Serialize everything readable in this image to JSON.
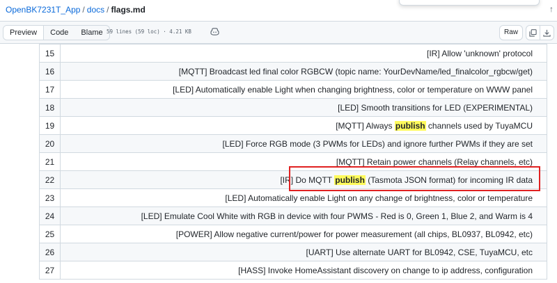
{
  "breadcrumb": {
    "repo": "OpenBK7231T_App",
    "dir": "docs",
    "file": "flags.md"
  },
  "toolbar": {
    "preview": "Preview",
    "code": "Code",
    "blame": "Blame",
    "file_meta": "59 lines (59 loc) · 4.21 KB",
    "raw": "Raw"
  },
  "rows": [
    {
      "num": "15",
      "text": "[IR] Allow 'unknown' protocol"
    },
    {
      "num": "16",
      "text": "[MQTT] Broadcast led final color RGBCW (topic name: YourDevName/led_finalcolor_rgbcw/get)"
    },
    {
      "num": "17",
      "text": "[LED] Automatically enable Light when changing brightness, color or temperature on WWW panel"
    },
    {
      "num": "18",
      "text": "[LED] Smooth transitions for LED (EXPERIMENTAL)"
    },
    {
      "num": "19",
      "pre": "[MQTT] Always ",
      "hl": "publish",
      "post": " channels used by TuyaMCU"
    },
    {
      "num": "20",
      "text": "[LED] Force RGB mode (3 PWMs for LEDs) and ignore further PWMs if they are set"
    },
    {
      "num": "21",
      "text": "[MQTT] Retain power channels (Relay channels, etc)"
    },
    {
      "num": "22",
      "pre": "[IR] Do MQTT ",
      "hl": "publish",
      "post": " (Tasmota JSON format) for incoming IR data"
    },
    {
      "num": "23",
      "text": "[LED] Automatically enable Light on any change of brightness, color or temperature"
    },
    {
      "num": "24",
      "text": "[LED] Emulate Cool White with RGB in device with four PWMS - Red is 0, Green 1, Blue 2, and Warm is 4"
    },
    {
      "num": "25",
      "text": "[POWER] Allow negative current/power for power measurement (all chips, BL0937, BL0942, etc)"
    },
    {
      "num": "26",
      "text": "[UART] Use alternate UART for BL0942, CSE, TuyaMCU, etc"
    },
    {
      "num": "27",
      "text": "[HASS] Invoke HomeAssistant discovery on change to ip address, configuration"
    }
  ],
  "colors": {
    "link": "#0969da",
    "highlight": "#fffb5c",
    "annotation_box": "#e02020"
  },
  "icons": [
    "copilot-icon",
    "copy-icon",
    "download-icon",
    "edit-icon",
    "arrow-up-icon"
  ]
}
